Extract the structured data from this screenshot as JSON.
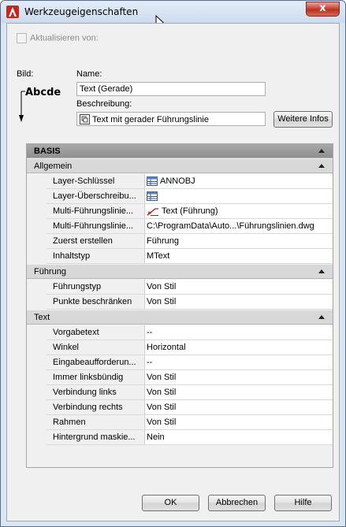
{
  "window": {
    "title": "Werkzeugeigenschaften",
    "close_label": "x"
  },
  "update": {
    "label": "Aktualisieren von:"
  },
  "image_label": "Bild:",
  "preview_text": "Abcde",
  "name": {
    "label": "Name:",
    "value": "Text (Gerade)"
  },
  "description": {
    "label": "Beschreibung:",
    "value": "Text mit gerader Führungslinie"
  },
  "more_info_button": "Weitere Infos",
  "grid": {
    "basis_label": "BASIS",
    "sections": [
      {
        "label": "Allgemein",
        "rows": [
          {
            "name": "Layer-Schlüssel",
            "value": "ANNOBJ",
            "icon": "layer-table-icon"
          },
          {
            "name": "Layer-Überschreibu...",
            "value": "",
            "icon": "layer-table-icon"
          },
          {
            "name": "Multi-Führungslinie...",
            "value": "Text (Führung)",
            "icon": "mleader-style-icon"
          },
          {
            "name": "Multi-Führungslinie...",
            "value": "C:\\ProgramData\\Auto...\\Führungslinien.dwg"
          },
          {
            "name": "Zuerst erstellen",
            "value": "Führung"
          },
          {
            "name": "Inhaltstyp",
            "value": "MText"
          }
        ]
      },
      {
        "label": "Führung",
        "rows": [
          {
            "name": "Führungstyp",
            "value": "Von Stil"
          },
          {
            "name": "Punkte beschränken",
            "value": "Von Stil"
          }
        ]
      },
      {
        "label": "Text",
        "rows": [
          {
            "name": "Vorgabetext",
            "value": "--"
          },
          {
            "name": "Winkel",
            "value": "Horizontal"
          },
          {
            "name": "Eingabeaufforderun...",
            "value": "--"
          },
          {
            "name": "Immer linksbündig",
            "value": "Von Stil"
          },
          {
            "name": "Verbindung links",
            "value": "Von Stil"
          },
          {
            "name": "Verbindung rechts",
            "value": "Von Stil"
          },
          {
            "name": "Rahmen",
            "value": "Von Stil"
          },
          {
            "name": "Hintergrund maskie...",
            "value": "Nein"
          }
        ]
      }
    ]
  },
  "buttons": {
    "ok": "OK",
    "cancel": "Abbrechen",
    "help": "Hilfe"
  },
  "colors": {
    "window_frame": "#dbe6f3",
    "close_red": "#c9483a",
    "category_bar": "#8f8f8f"
  }
}
